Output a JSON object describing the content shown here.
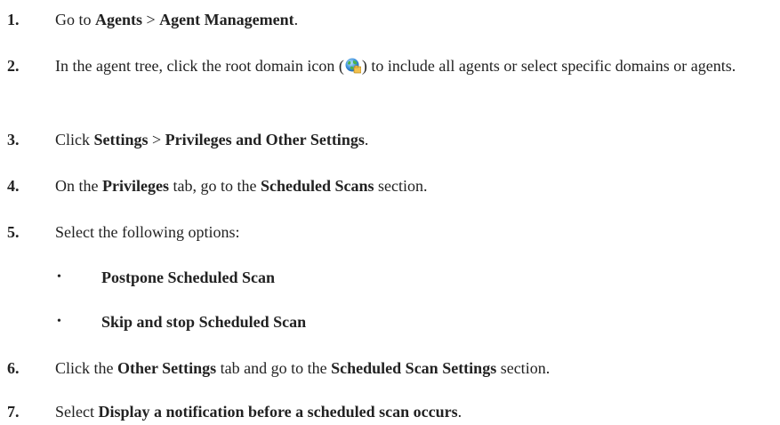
{
  "steps": [
    {
      "num": "1.",
      "parts": [
        {
          "t": "Go to "
        },
        {
          "t": "Agents",
          "b": true
        },
        {
          "t": " > "
        },
        {
          "t": "Agent Management",
          "b": true
        },
        {
          "t": "."
        }
      ]
    },
    {
      "num": "2.",
      "parts": [
        {
          "t": "In the agent tree, click the root domain icon ("
        },
        {
          "icon": "root-domain-globe-icon"
        },
        {
          "t": ") to include all agents or select specific domains or agents."
        }
      ]
    },
    {
      "num": "3.",
      "parts": [
        {
          "t": "Click "
        },
        {
          "t": "Settings",
          "b": true
        },
        {
          "t": " > "
        },
        {
          "t": "Privileges and Other Settings",
          "b": true
        },
        {
          "t": "."
        }
      ]
    },
    {
      "num": "4.",
      "parts": [
        {
          "t": "On the "
        },
        {
          "t": "Privileges",
          "b": true
        },
        {
          "t": " tab, go to the "
        },
        {
          "t": "Scheduled Scans",
          "b": true
        },
        {
          "t": " section."
        }
      ]
    },
    {
      "num": "5.",
      "parts": [
        {
          "t": "Select the following options:"
        }
      ]
    },
    {
      "num": "6.",
      "parts": [
        {
          "t": "Click the "
        },
        {
          "t": "Other Settings",
          "b": true
        },
        {
          "t": " tab and go to the "
        },
        {
          "t": "Scheduled Scan Settings",
          "b": true
        },
        {
          "t": " section."
        }
      ]
    },
    {
      "num": "7.",
      "parts": [
        {
          "t": "Select "
        },
        {
          "t": "Display a notification before a scheduled scan occurs",
          "b": true
        },
        {
          "t": "."
        }
      ]
    }
  ],
  "options": [
    {
      "bullet": "•",
      "label": "Postpone Scheduled Scan"
    },
    {
      "bullet": "•",
      "label": "Skip and stop Scheduled Scan"
    }
  ],
  "icon_names": {
    "globe": "root-domain-globe-icon"
  }
}
